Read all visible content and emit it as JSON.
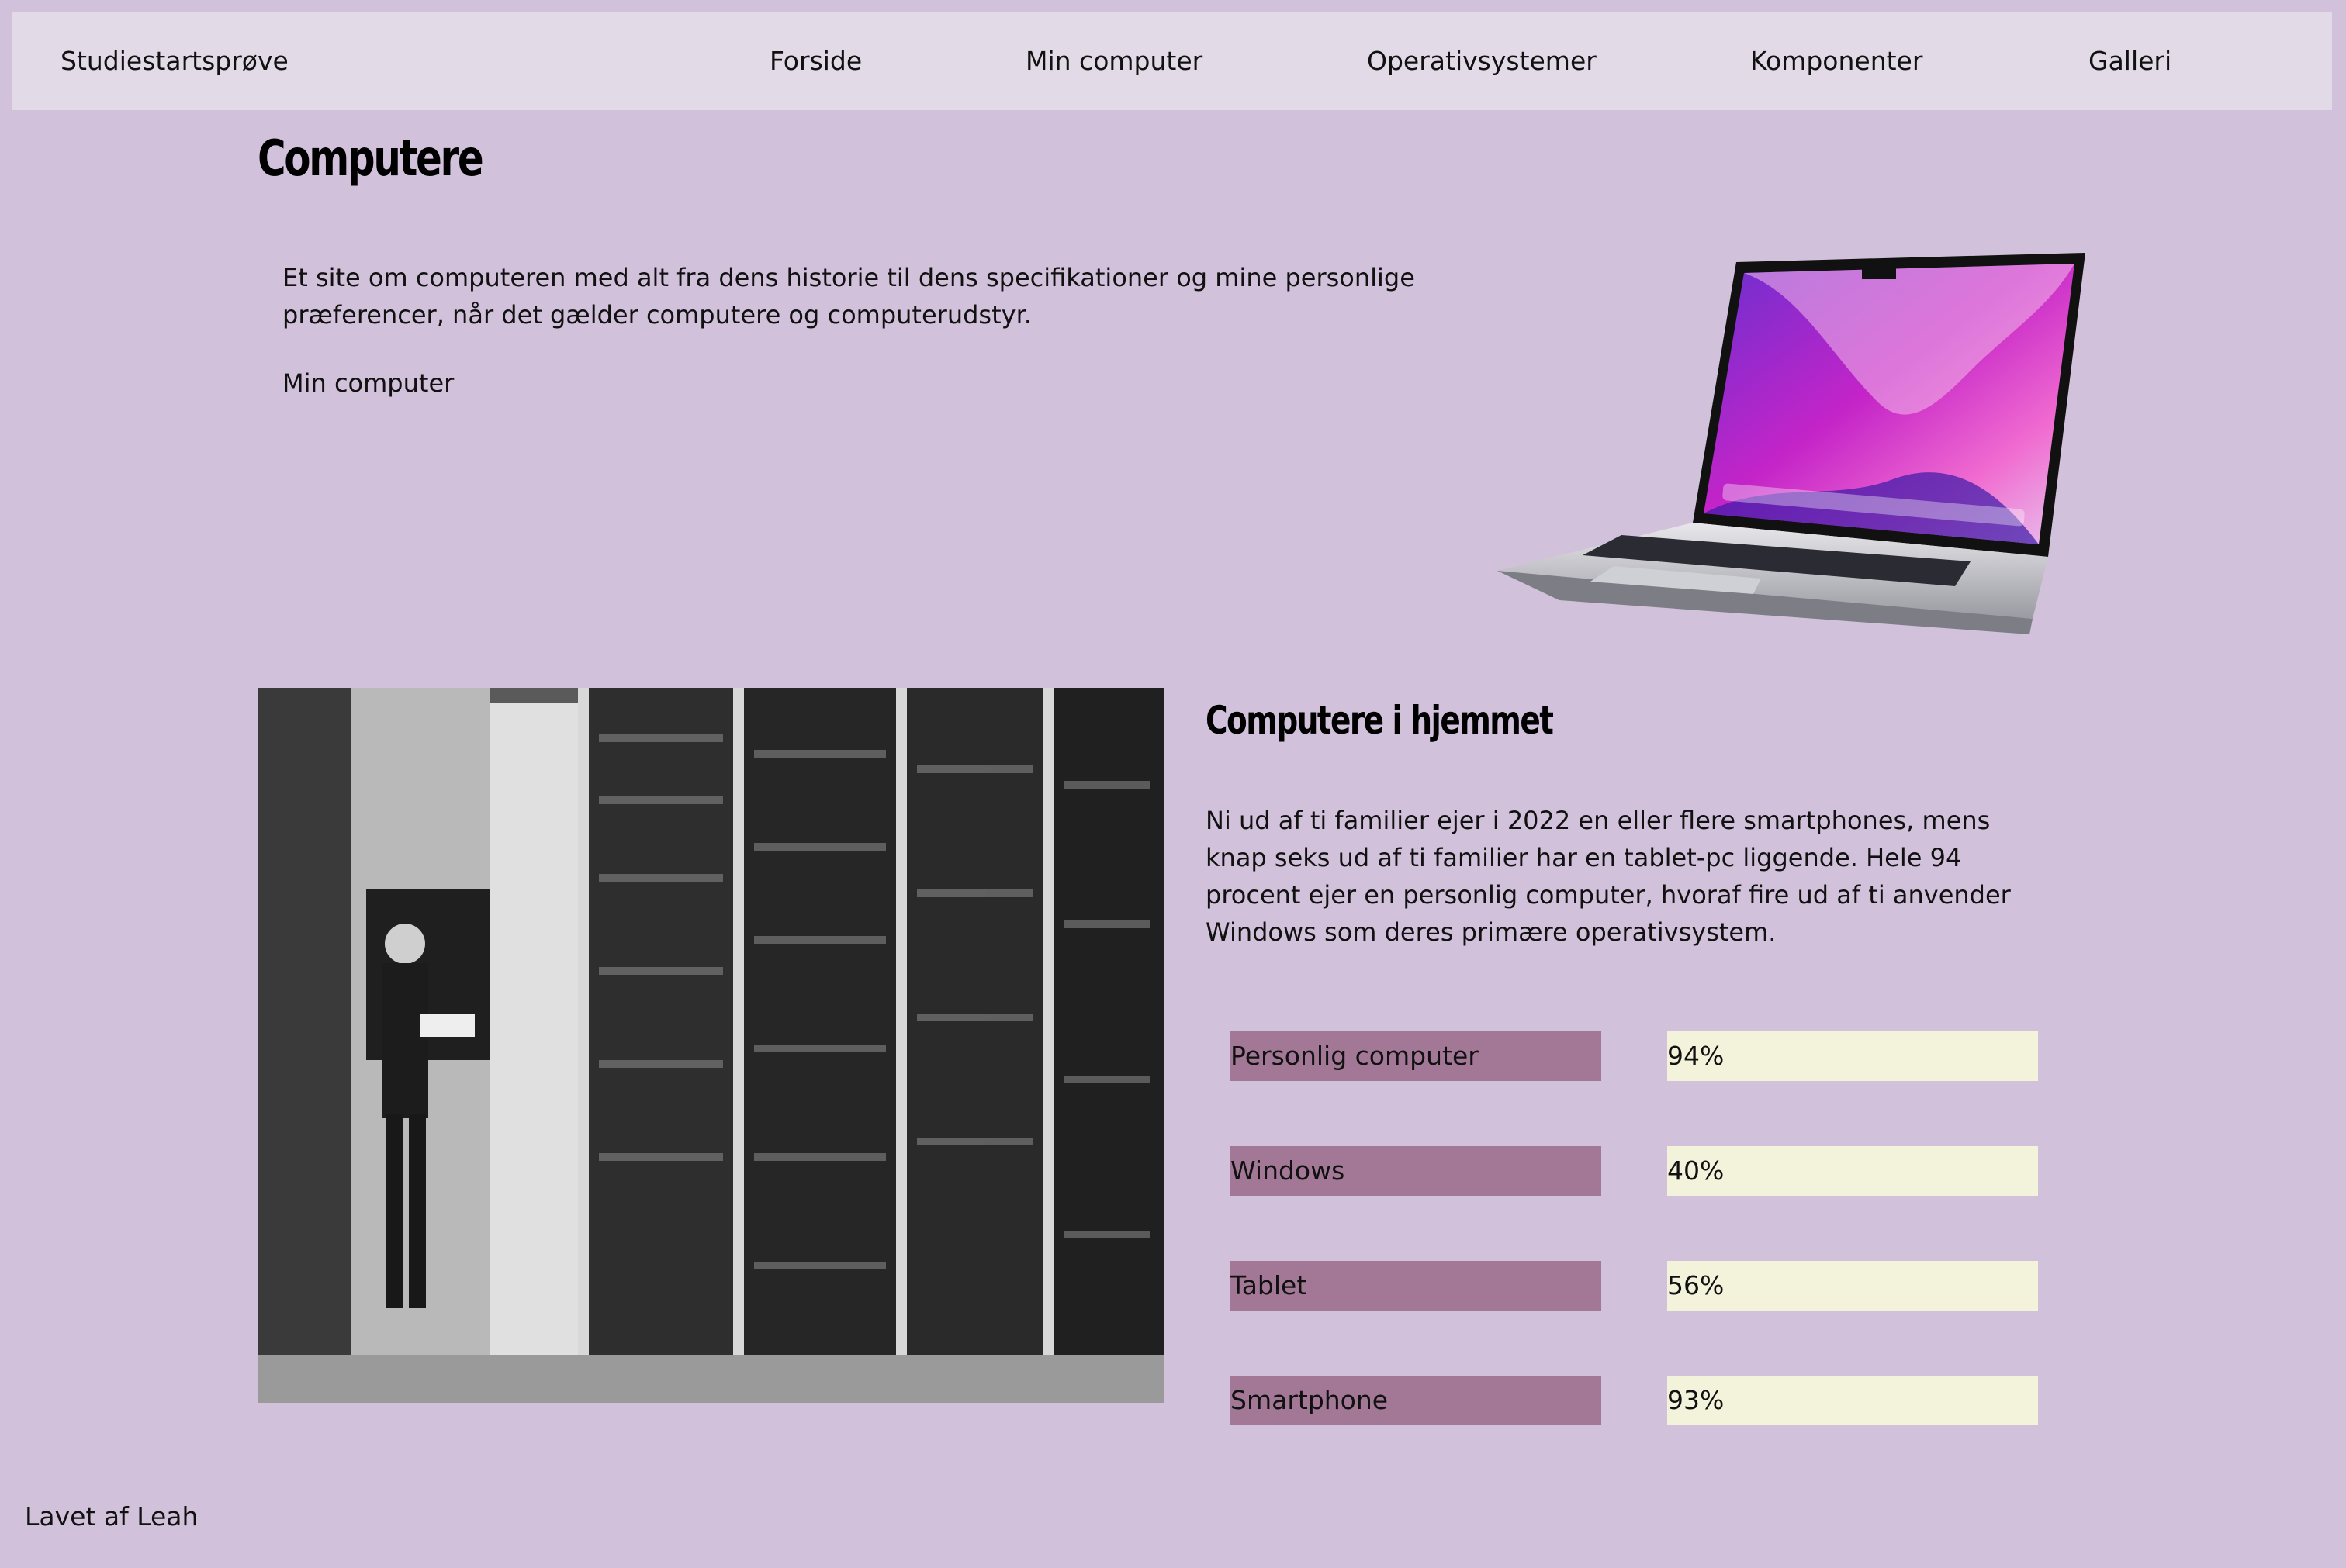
{
  "nav": {
    "brand": "Studiestartsprøve",
    "links": [
      "Forside",
      "Min computer",
      "Operativsystemer",
      "Komponenter",
      "Galleri"
    ]
  },
  "header": {
    "title": "Computere"
  },
  "intro": {
    "text": "Et site om computeren med alt fra dens historie til dens specifikationer og mine personlige præferencer, når det gælder computere og computerudstyr.",
    "link": "Min computer"
  },
  "home": {
    "title": "Computere i hjemmet",
    "text": "Ni ud af ti familier ejer i 2022 en eller flere smartphones, mens knap seks ud af ti familier har en tablet-pc liggende. Hele 94 procent ejer en personlig computer, hvoraf fire ud af ti anvender Windows som deres primære operativsystem.",
    "stats": [
      {
        "label": "Personlig computer",
        "value": "94%"
      },
      {
        "label": "Windows",
        "value": "40%"
      },
      {
        "label": "Tablet",
        "value": "56%"
      },
      {
        "label": "Smartphone",
        "value": "93%"
      }
    ]
  },
  "footer": {
    "text": "Lavet af Leah"
  },
  "colors": {
    "background": "#d1c1da",
    "navbar": "#e2dbe7",
    "stat_label_bg": "#a27896",
    "stat_value_bg": "#f3f3dc"
  }
}
